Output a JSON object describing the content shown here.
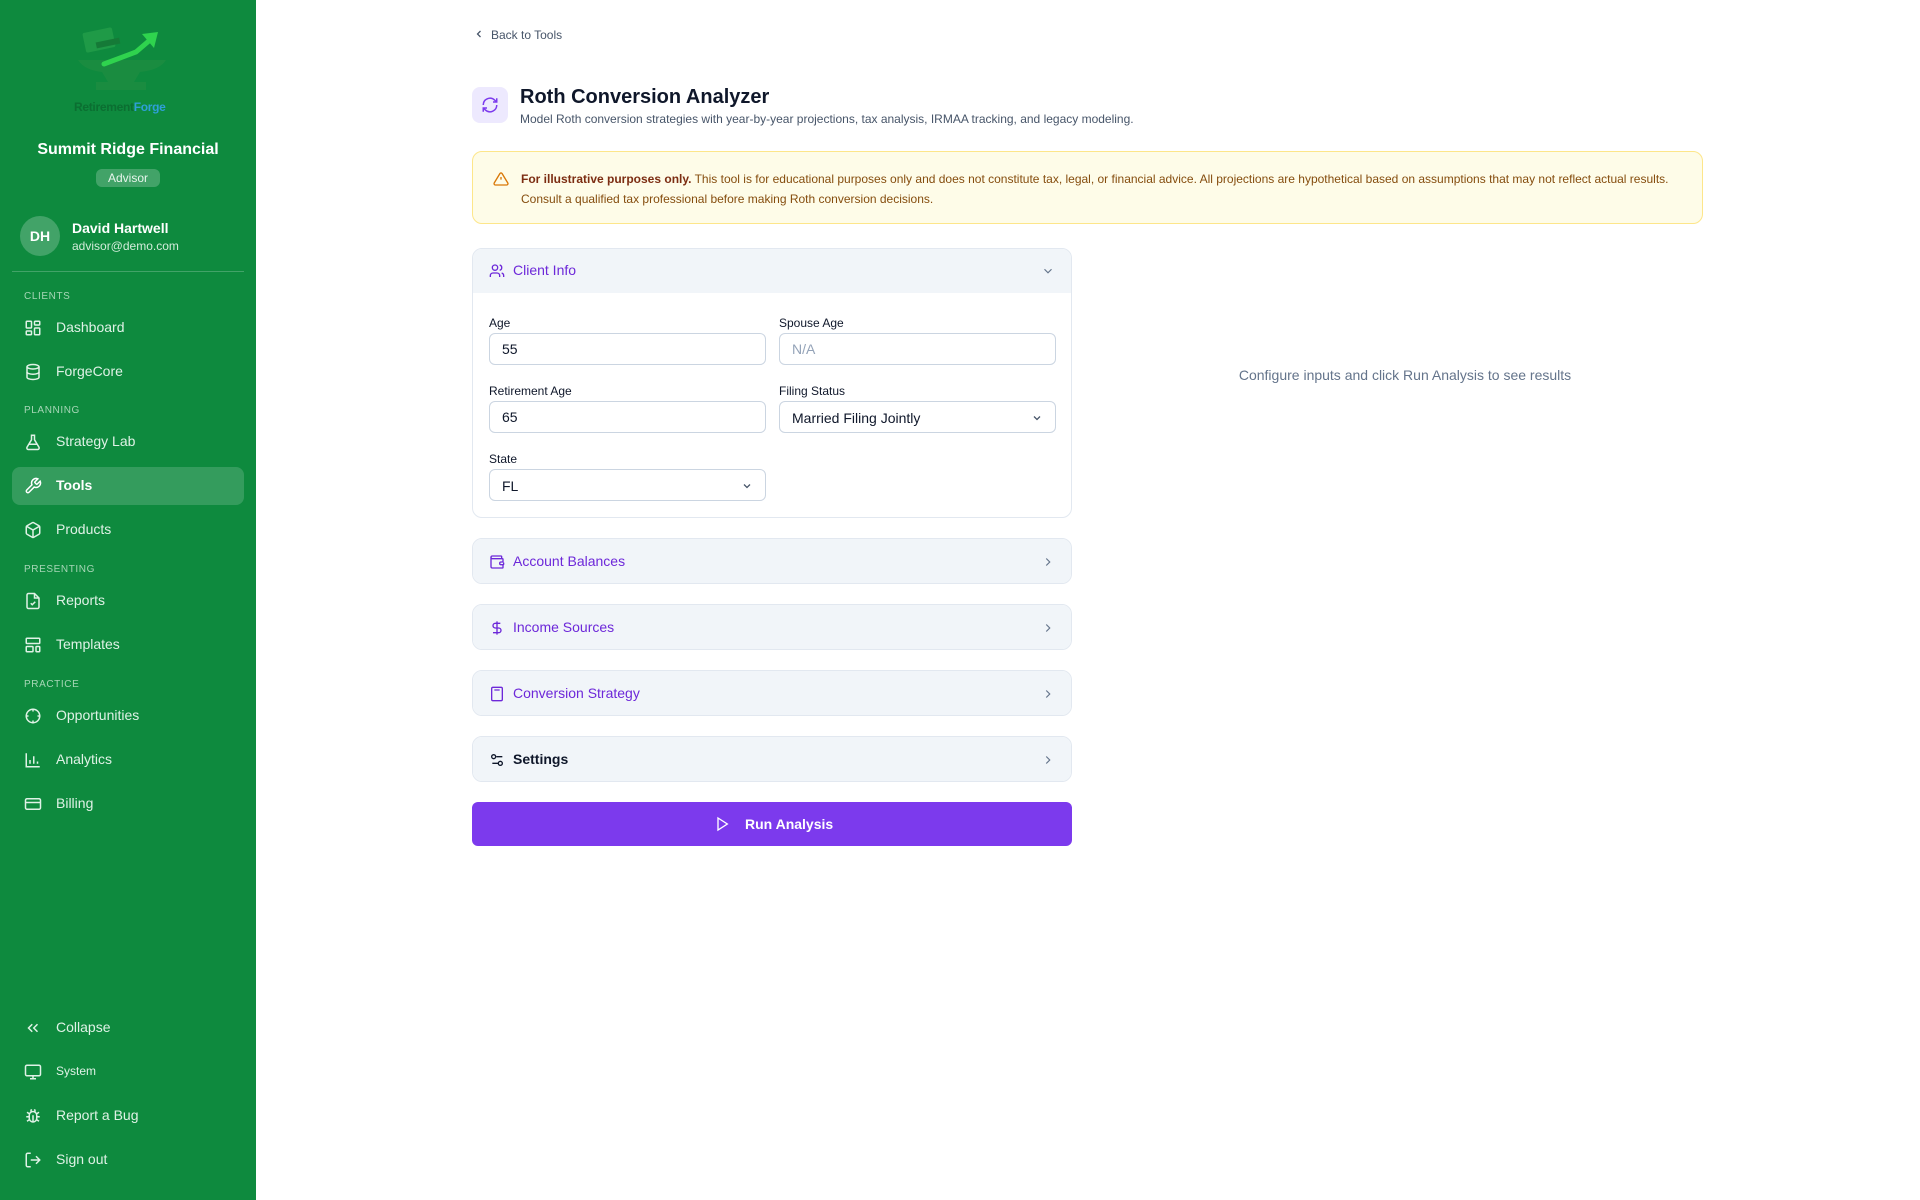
{
  "brand": {
    "logo_word_1": "Retirement",
    "logo_word_2": "Forge"
  },
  "sidebar": {
    "org_name": "Summit Ridge Financial",
    "role": "Advisor",
    "user": {
      "initials": "DH",
      "name": "David Hartwell",
      "email": "advisor@demo.com"
    },
    "sections": [
      "CLIENTS",
      "PLANNING",
      "PRESENTING",
      "PRACTICE"
    ],
    "items": [
      {
        "label": "Dashboard",
        "icon": "dashboard-icon"
      },
      {
        "label": "ForgeCore",
        "icon": "database-icon"
      },
      {
        "label": "Strategy Lab",
        "icon": "flask-icon"
      },
      {
        "label": "Tools",
        "icon": "wrench-icon",
        "active": true
      },
      {
        "label": "Products",
        "icon": "package-icon"
      },
      {
        "label": "Reports",
        "icon": "file-check-icon"
      },
      {
        "label": "Templates",
        "icon": "layout-template-icon"
      },
      {
        "label": "Opportunities",
        "icon": "crosshair-icon"
      },
      {
        "label": "Analytics",
        "icon": "bar-chart-icon"
      },
      {
        "label": "Billing",
        "icon": "credit-card-icon"
      }
    ],
    "footer": [
      {
        "label": "Collapse",
        "icon": "chevrons-left-icon"
      },
      {
        "label": "System",
        "icon": "monitor-icon"
      },
      {
        "label": "Report a Bug",
        "icon": "bug-icon"
      },
      {
        "label": "Sign out",
        "icon": "log-out-icon"
      }
    ]
  },
  "header": {
    "back_label": "Back to Tools",
    "title": "Roth Conversion Analyzer",
    "subtitle": "Model Roth conversion strategies with year-by-year projections, tax analysis, IRMAA tracking, and legacy modeling."
  },
  "disclaimer": {
    "bold": "For illustrative purposes only.",
    "text": " This tool is for educational purposes only and does not constitute tax, legal, or financial advice. All projections are hypothetical based on assumptions that may not reflect actual results. Consult a qualified tax professional before making Roth conversion decisions."
  },
  "client_info": {
    "title": "Client Info",
    "age_label": "Age",
    "age_value": "55",
    "spouse_age_label": "Spouse Age",
    "spouse_age_placeholder": "N/A",
    "retirement_age_label": "Retirement Age",
    "retirement_age_value": "65",
    "filing_status_label": "Filing Status",
    "filing_status_value": "Married Filing Jointly",
    "state_label": "State",
    "state_value": "FL"
  },
  "sections": {
    "account_balances": "Account Balances",
    "income_sources": "Income Sources",
    "conversion_strategy": "Conversion Strategy",
    "settings": "Settings"
  },
  "run_button": "Run Analysis",
  "results_empty": "Configure inputs and click Run Analysis to see results",
  "colors": {
    "sidebar": "#0e8a3e",
    "accent": "#7c3aed",
    "warning_bg": "#fefce8"
  }
}
